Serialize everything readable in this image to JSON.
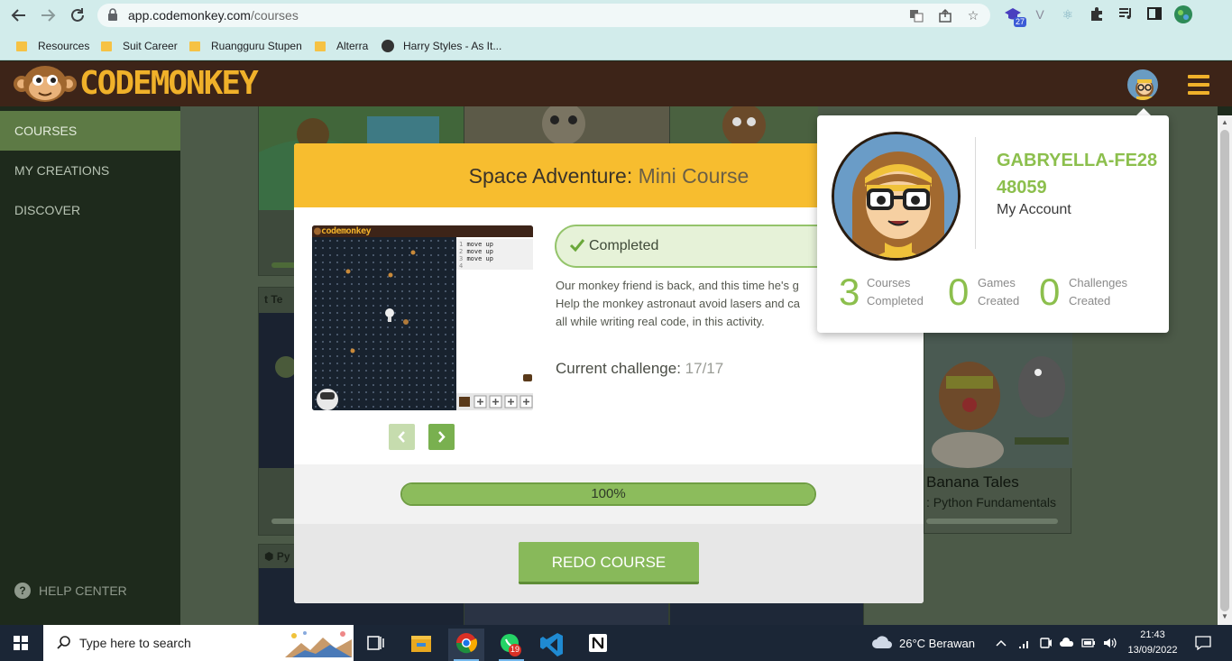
{
  "browser": {
    "url_host": "app.codemonkey.com",
    "url_path": "/courses",
    "bookmarks": [
      "Resources",
      "Suit Career",
      "Ruangguru Stupen",
      "Alterra",
      "Harry Styles - As It..."
    ],
    "extension_badge": "27"
  },
  "app": {
    "logo_text": "CODEMONKEY",
    "brand_color": "#f0b12a"
  },
  "sidebar": {
    "items": [
      {
        "label": "COURSES",
        "active": true
      },
      {
        "label": "MY CREATIONS",
        "active": false
      },
      {
        "label": "DISCOVER",
        "active": false
      }
    ],
    "help_label": "HELP CENTER"
  },
  "background_cards": {
    "visible_card_title": "Banana Tales",
    "visible_card_subtitle": ": Python Fundamentals",
    "tag_partial_1": "Te",
    "tag_partial_2": "Py"
  },
  "modal": {
    "course_name": "Space Adventure:",
    "course_kind": "Mini Course",
    "status": "Completed",
    "description_lines": [
      "Our monkey friend is back, and this time he's g",
      "Help the monkey astronaut avoid lasers and ca",
      "all while writing real code, in this activity."
    ],
    "challenge_label": "Current challenge:",
    "challenge_value": "17/17",
    "progress_percent": 100,
    "progress_label": "100%",
    "redo_label": "REDO COURSE",
    "preview": {
      "logo_text": "codemonkey",
      "code_lines": [
        "move up",
        "move up",
        "move up",
        ""
      ],
      "line_numbers": [
        "1",
        "2",
        "3",
        "4"
      ]
    }
  },
  "account": {
    "username": "GABRYELLA-FE2848059",
    "my_account_label": "My Account",
    "stats": [
      {
        "value": "3",
        "label_line1": "Courses",
        "label_line2": "Completed"
      },
      {
        "value": "0",
        "label_line1": "Games",
        "label_line2": "Created"
      },
      {
        "value": "0",
        "label_line1": "Challenges",
        "label_line2": "Created"
      }
    ]
  },
  "taskbar": {
    "search_placeholder": "Type here to search",
    "whatsapp_badge": "19",
    "weather": "26°C  Berawan",
    "time": "21:43",
    "date": "13/09/2022"
  }
}
